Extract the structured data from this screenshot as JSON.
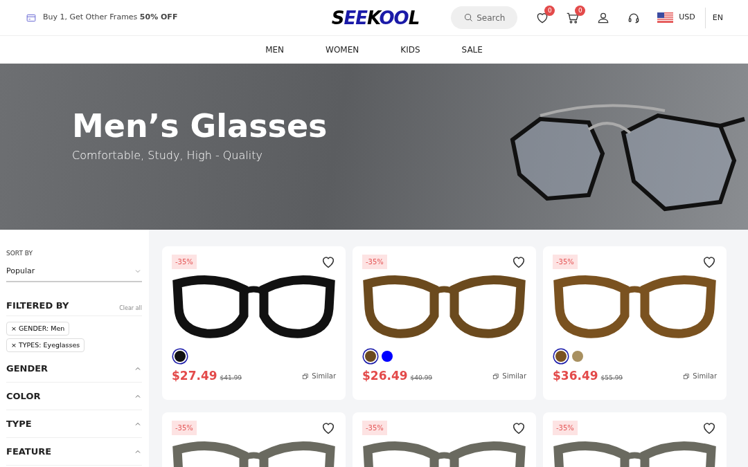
{
  "promo": {
    "text": "Buy 1, Get Other Frames **50% OFF**"
  },
  "logo": "SEEKOOL",
  "search": {
    "placeholder": "Search"
  },
  "wishlist": {
    "count": "0"
  },
  "cart": {
    "count": "0"
  },
  "currency": "USD",
  "language": "EN",
  "nav": [
    {
      "label": "MEN"
    },
    {
      "label": "WOMEN"
    },
    {
      "label": "KIDS"
    },
    {
      "label": "SALE"
    }
  ],
  "hero": {
    "title": "Men’s Glasses",
    "subtitle": "Comfortable, Study, High - Quality"
  },
  "sidebar": {
    "sort_label": "SORT BY",
    "sort_value": "Popular",
    "filtered_title": "FILTERED BY",
    "clear_all": "Clear all",
    "chips": [
      {
        "remove": "×",
        "label": "GENDER: Men"
      },
      {
        "remove": "×",
        "label": "TYPES: Eyeglasses"
      }
    ],
    "sections": [
      {
        "title": "GENDER",
        "expanded": true
      },
      {
        "title": "COLOR",
        "expanded": true
      },
      {
        "title": "TYPE",
        "expanded": true
      },
      {
        "title": "FEATURE",
        "expanded": true
      }
    ]
  },
  "products": [
    {
      "discount": "-35%",
      "price": "$27.49",
      "old_price": "$41.99",
      "similar": "Similar",
      "swatches": [
        {
          "color": "#111111",
          "selected": true
        }
      ]
    },
    {
      "discount": "-35%",
      "price": "$26.49",
      "old_price": "$40.99",
      "similar": "Similar",
      "swatches": [
        {
          "color": "#6b4a1e",
          "selected": true
        },
        {
          "color": "#0000ff",
          "selected": false
        }
      ]
    },
    {
      "discount": "-35%",
      "price": "$36.49",
      "old_price": "$55.99",
      "similar": "Similar",
      "swatches": [
        {
          "color": "#7a5220",
          "selected": true
        },
        {
          "color": "#a89060",
          "selected": false
        }
      ]
    },
    {
      "discount": "-35%"
    },
    {
      "discount": "-35%"
    },
    {
      "discount": "-35%"
    }
  ]
}
